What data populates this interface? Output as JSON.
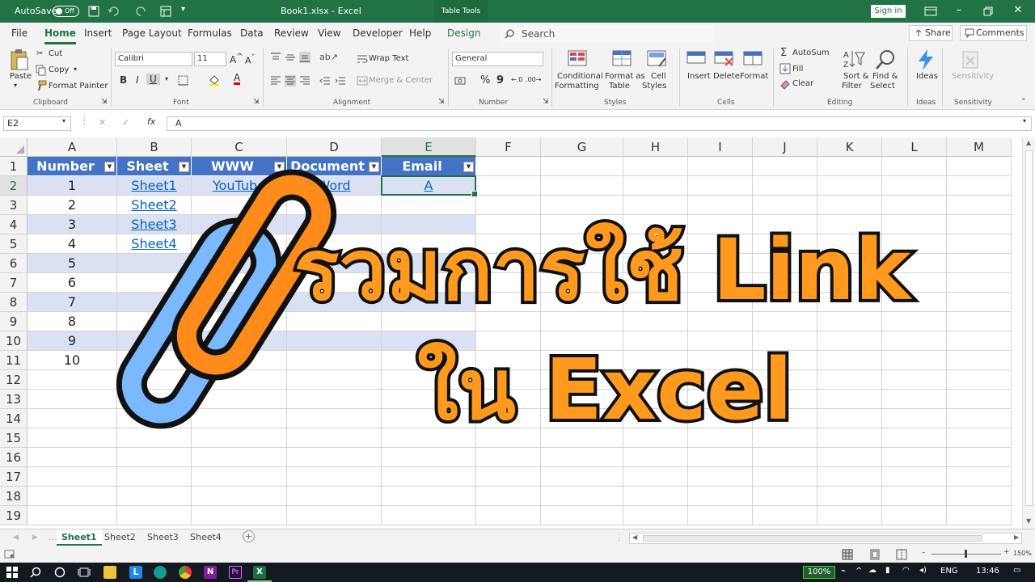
{
  "titlebar": {
    "autosave_label": "AutoSave",
    "autosave_state": "Off",
    "doc_title": "Book1.xlsx  -  Excel",
    "table_tools": "Table Tools",
    "signin": "Sign in"
  },
  "menu": {
    "tabs": [
      "File",
      "Home",
      "Insert",
      "Page Layout",
      "Formulas",
      "Data",
      "Review",
      "View",
      "Developer",
      "Help",
      "Design"
    ],
    "search_placeholder": "Search",
    "share": "Share",
    "comments": "Comments"
  },
  "ribbon": {
    "clipboard": {
      "paste": "Paste",
      "cut": "Cut",
      "copy": "Copy",
      "format_painter": "Format Painter",
      "label": "Clipboard"
    },
    "font": {
      "name": "Calibri",
      "size": "11",
      "bold": "B",
      "italic": "I",
      "underline": "U",
      "label": "Font"
    },
    "alignment": {
      "wrap": "Wrap Text",
      "merge": "Merge & Center",
      "label": "Alignment"
    },
    "number": {
      "format": "General",
      "percent": "%",
      "comma": "9",
      "label": "Number"
    },
    "styles": {
      "conditional": [
        "Conditional",
        "Formatting"
      ],
      "format_table": [
        "Format as",
        "Table"
      ],
      "cell_styles": [
        "Cell",
        "Styles"
      ],
      "label": "Styles"
    },
    "cells": {
      "insert": "Insert",
      "delete": "Delete",
      "format": "Format",
      "label": "Cells"
    },
    "editing": {
      "autosum": "AutoSum",
      "fill": "Fill",
      "clear": "Clear",
      "sort": [
        "Sort &",
        "Filter"
      ],
      "find": [
        "Find &",
        "Select"
      ],
      "label": "Editing"
    },
    "ideas": {
      "button": "Ideas",
      "label": "Ideas"
    },
    "sensitivity": {
      "button": "Sensitivity",
      "label": "Sensitivity"
    }
  },
  "formula_bar": {
    "name_box": "E2",
    "fx": "fx",
    "value": "A"
  },
  "columns": [
    "A",
    "B",
    "C",
    "D",
    "E",
    "F",
    "G",
    "H",
    "I",
    "J",
    "K",
    "L",
    "M"
  ],
  "rows": [
    "1",
    "2",
    "3",
    "4",
    "5",
    "6",
    "7",
    "8",
    "9",
    "10",
    "11",
    "12",
    "13",
    "14",
    "15",
    "16",
    "17",
    "18",
    "19"
  ],
  "table": {
    "headers": [
      "Number",
      "Sheet",
      "WWW",
      "Document",
      "Email"
    ],
    "numbers": [
      "1",
      "2",
      "3",
      "4",
      "5",
      "6",
      "7",
      "8",
      "9",
      "10"
    ],
    "sheet_links": [
      "Sheet1",
      "Sheet2",
      "Sheet3",
      "Sheet4"
    ],
    "www_link": "YouTube",
    "document_link": "Word",
    "email_link": "A"
  },
  "sheet_tabs": [
    "Sheet1",
    "Sheet2",
    "Sheet3",
    "Sheet4"
  ],
  "status": {
    "zoom": "150%",
    "taskbar_zoom": "100%",
    "lang": "ENG",
    "time": "13:46"
  },
  "overlay": {
    "line1": "รวมการใช้ Link",
    "line2": "ใน Excel"
  },
  "colors": {
    "excel_green": "#217346",
    "table_blue": "#4472c4",
    "band": "#d9e1f2",
    "chain_orange": "#ff8c1a",
    "chain_blue": "#7ab8ff"
  }
}
